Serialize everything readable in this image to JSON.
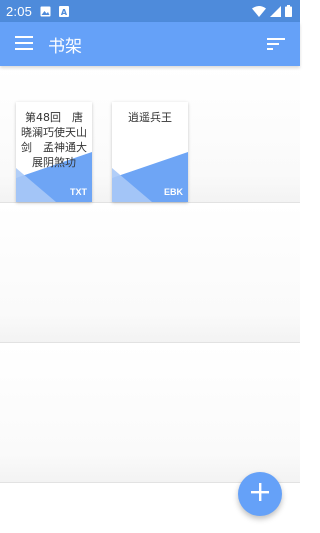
{
  "status_bar": {
    "time": "2:05",
    "icons": [
      "image-notification-icon",
      "a-notification-icon",
      "wifi-icon",
      "signal-icon",
      "battery-icon"
    ]
  },
  "app_bar": {
    "title": "书架",
    "menu_icon": "menu-icon",
    "sort_icon": "sort-icon"
  },
  "books": [
    {
      "title": "第48回　唐晓澜巧使天山剑　孟神通大展阴煞功",
      "type": "TXT"
    },
    {
      "title": "逍遥兵王",
      "type": "EBK"
    }
  ],
  "fab": {
    "icon": "add-icon"
  },
  "colors": {
    "status_bar": "#4e8bdb",
    "app_bar": "#65a1f8",
    "cover_accent": "#6ea5f5",
    "cover_accent_light": "#a9c9f7"
  }
}
